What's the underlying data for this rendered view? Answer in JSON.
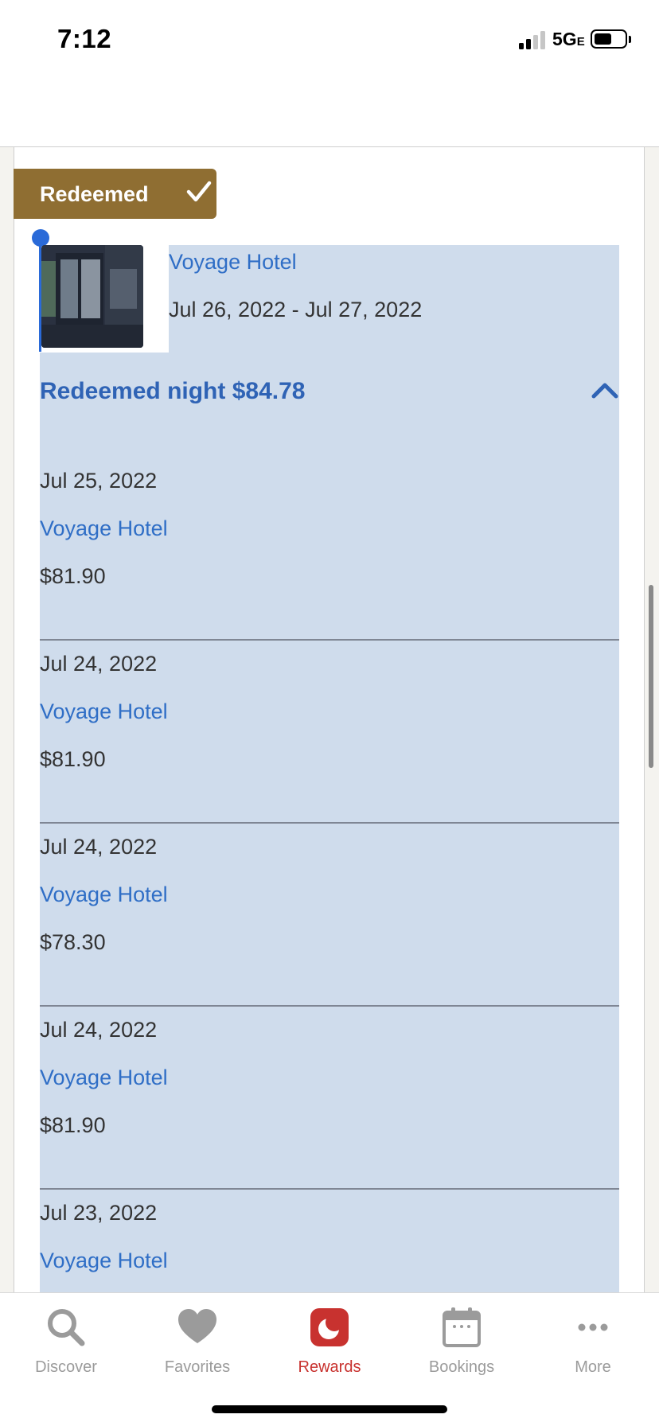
{
  "status_bar": {
    "time": "7:12",
    "network": "5G",
    "network_suffix": "E",
    "battery_level": 0.5
  },
  "reward": {
    "status_label": "Redeemed",
    "status_icon": "checkmark-icon",
    "hotel_name": "Voyage Hotel",
    "date_range": "Jul 26, 2022 - Jul 27, 2022",
    "summary": "Redeemed night $84.78",
    "expanded": true
  },
  "nights": [
    {
      "date": "Jul 25, 2022",
      "hotel": "Voyage Hotel",
      "price": "$81.90"
    },
    {
      "date": "Jul 24, 2022",
      "hotel": "Voyage Hotel",
      "price": "$81.90"
    },
    {
      "date": "Jul 24, 2022",
      "hotel": "Voyage Hotel",
      "price": "$78.30"
    },
    {
      "date": "Jul 24, 2022",
      "hotel": "Voyage Hotel",
      "price": "$81.90"
    },
    {
      "date": "Jul 23, 2022",
      "hotel": "Voyage Hotel",
      "price": ""
    }
  ],
  "tab_bar": {
    "items": [
      {
        "label": "Discover",
        "icon": "search-icon"
      },
      {
        "label": "Favorites",
        "icon": "heart-icon"
      },
      {
        "label": "Rewards",
        "icon": "moon-icon"
      },
      {
        "label": "Bookings",
        "icon": "calendar-icon"
      },
      {
        "label": "More",
        "icon": "more-dots-icon"
      }
    ],
    "active": "Rewards"
  },
  "colors": {
    "accent_blue": "#2f6ec6",
    "tag_gold": "#8f6e32",
    "selection": "#cfdcec",
    "rewards_red": "#c8322f"
  }
}
